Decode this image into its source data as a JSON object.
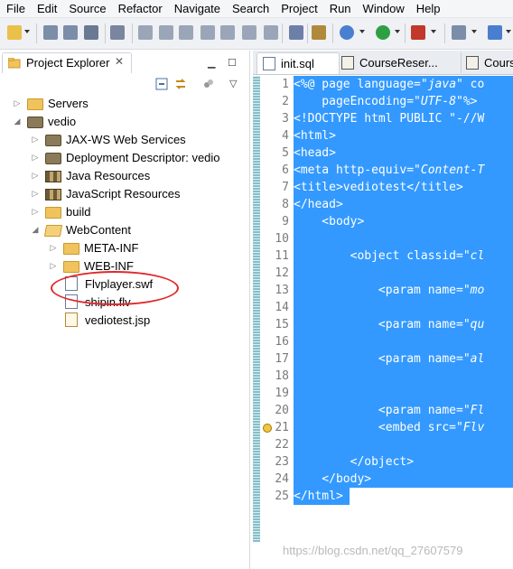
{
  "menubar": {
    "items": [
      "File",
      "Edit",
      "Source",
      "Refactor",
      "Navigate",
      "Search",
      "Project",
      "Run",
      "Window",
      "Help"
    ]
  },
  "toolbar": {
    "icons": [
      "new-icon",
      "save-icon",
      "save-all-icon",
      "print-icon",
      "skip-breakpoints-icon",
      "resume-icon",
      "suspend-icon",
      "terminate-icon",
      "disconnect-icon",
      "step-into-icon",
      "step-over-icon",
      "step-return-icon",
      "open-task-icon",
      "open-type-icon",
      "debug-icon",
      "run-icon",
      "external-tools-icon",
      "new-server-icon",
      "new-java-class-icon"
    ]
  },
  "project_explorer": {
    "title": "Project Explorer",
    "tree": [
      {
        "label": "Servers",
        "depth": 0,
        "expanded": false,
        "icon": "folder-icon"
      },
      {
        "label": "vedio",
        "depth": 0,
        "expanded": true,
        "icon": "project-icon"
      },
      {
        "label": "JAX-WS Web Services",
        "depth": 1,
        "expanded": false,
        "icon": "webservice-icon"
      },
      {
        "label": "Deployment Descriptor: vedio",
        "depth": 1,
        "expanded": false,
        "icon": "descriptor-icon"
      },
      {
        "label": "Java Resources",
        "depth": 1,
        "expanded": false,
        "icon": "library-icon"
      },
      {
        "label": "JavaScript Resources",
        "depth": 1,
        "expanded": false,
        "icon": "library-icon"
      },
      {
        "label": "build",
        "depth": 1,
        "expanded": false,
        "icon": "folder-icon"
      },
      {
        "label": "WebContent",
        "depth": 1,
        "expanded": true,
        "icon": "folder-open-icon"
      },
      {
        "label": "META-INF",
        "depth": 2,
        "expanded": false,
        "icon": "folder-icon"
      },
      {
        "label": "WEB-INF",
        "depth": 2,
        "expanded": false,
        "icon": "folder-icon"
      },
      {
        "label": "Flvplayer.swf",
        "depth": 2,
        "expanded": null,
        "icon": "file-icon"
      },
      {
        "label": "shipin.flv",
        "depth": 2,
        "expanded": null,
        "icon": "file-icon"
      },
      {
        "label": "vediotest.jsp",
        "depth": 2,
        "expanded": null,
        "icon": "jsp-file-icon"
      }
    ]
  },
  "editor": {
    "tabs": [
      {
        "label": "init.sql",
        "active": true
      },
      {
        "label": "CourseReser...",
        "active": false
      },
      {
        "label": "Course",
        "active": false
      }
    ],
    "lines": [
      {
        "n": "1",
        "segs": [
          {
            "t": "<%@ page language=\"",
            "i": false
          },
          {
            "t": "java",
            "i": true
          },
          {
            "t": "\" co",
            "i": false
          }
        ]
      },
      {
        "n": "2",
        "segs": [
          {
            "t": "    pageEncoding=\"",
            "i": false
          },
          {
            "t": "UTF-8",
            "i": true
          },
          {
            "t": "\"%>",
            "i": false
          }
        ]
      },
      {
        "n": "3",
        "segs": [
          {
            "t": "<!DOCTYPE html PUBLIC \"-//W",
            "i": false
          }
        ]
      },
      {
        "n": "4",
        "segs": [
          {
            "t": "<html>",
            "i": false
          }
        ]
      },
      {
        "n": "5",
        "segs": [
          {
            "t": "<head>",
            "i": false
          }
        ]
      },
      {
        "n": "6",
        "segs": [
          {
            "t": "<meta http-equiv=\"",
            "i": false
          },
          {
            "t": "Content-T",
            "i": true
          }
        ]
      },
      {
        "n": "7",
        "segs": [
          {
            "t": "<title>vediotest</title>",
            "i": false
          }
        ]
      },
      {
        "n": "8",
        "segs": [
          {
            "t": "</head>",
            "i": false
          }
        ]
      },
      {
        "n": "9",
        "segs": [
          {
            "t": "    <body>",
            "i": false
          }
        ]
      },
      {
        "n": "10",
        "segs": [
          {
            "t": "",
            "i": false
          }
        ]
      },
      {
        "n": "11",
        "segs": [
          {
            "t": "        <object classid=\"",
            "i": false
          },
          {
            "t": "cl",
            "i": true
          }
        ]
      },
      {
        "n": "12",
        "segs": [
          {
            "t": "",
            "i": false
          }
        ]
      },
      {
        "n": "13",
        "segs": [
          {
            "t": "            <param name=\"",
            "i": false
          },
          {
            "t": "mo",
            "i": true
          }
        ]
      },
      {
        "n": "14",
        "segs": [
          {
            "t": "",
            "i": false
          }
        ]
      },
      {
        "n": "15",
        "segs": [
          {
            "t": "            <param name=\"",
            "i": false
          },
          {
            "t": "qu",
            "i": true
          }
        ]
      },
      {
        "n": "16",
        "segs": [
          {
            "t": "",
            "i": false
          }
        ]
      },
      {
        "n": "17",
        "segs": [
          {
            "t": "            <param name=\"",
            "i": false
          },
          {
            "t": "al",
            "i": true
          }
        ]
      },
      {
        "n": "18",
        "segs": [
          {
            "t": "",
            "i": false
          }
        ]
      },
      {
        "n": "19",
        "segs": [
          {
            "t": "",
            "i": false
          }
        ]
      },
      {
        "n": "20",
        "segs": [
          {
            "t": "            <param name=\"",
            "i": false
          },
          {
            "t": "Fl",
            "i": true
          }
        ]
      },
      {
        "n": "21",
        "segs": [
          {
            "t": "            <embed src=\"",
            "i": false
          },
          {
            "t": "Flv",
            "i": true
          }
        ]
      },
      {
        "n": "22",
        "segs": [
          {
            "t": "",
            "i": false
          }
        ]
      },
      {
        "n": "23",
        "segs": [
          {
            "t": "        </object>",
            "i": false
          }
        ]
      },
      {
        "n": "24",
        "segs": [
          {
            "t": "    </body>",
            "i": false
          }
        ]
      },
      {
        "n": "25",
        "segs": [
          {
            "t": "</html>",
            "i": false
          }
        ]
      }
    ]
  },
  "watermark": "https://blog.csdn.net/qq_27607579",
  "colors": {
    "selection": "#3399ff",
    "annotation": "#e0282a"
  }
}
